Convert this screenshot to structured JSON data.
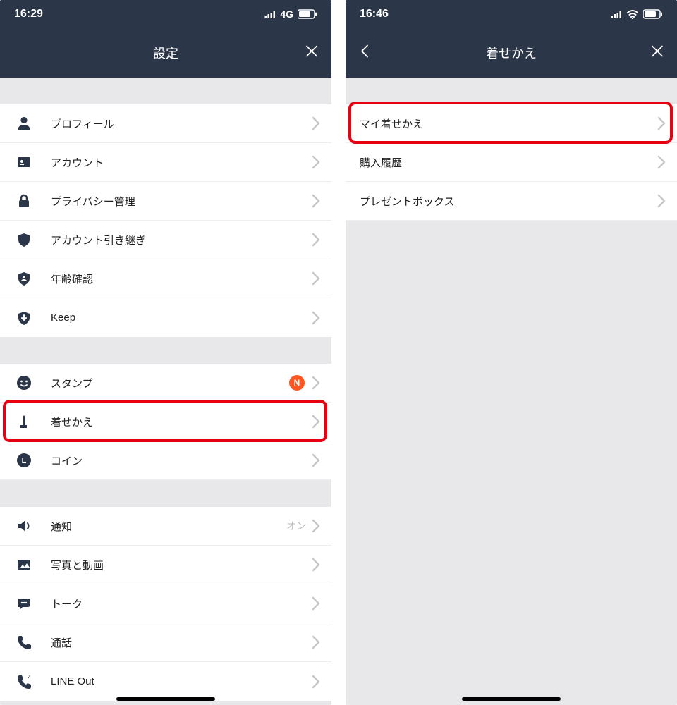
{
  "left": {
    "statusbar": {
      "time": "16:29",
      "network": "4G"
    },
    "navbar": {
      "title": "設定"
    },
    "groups": [
      {
        "items": [
          {
            "icon": "person-icon",
            "label": "プロフィール"
          },
          {
            "icon": "id-card-icon",
            "label": "アカウント"
          },
          {
            "icon": "lock-icon",
            "label": "プライバシー管理"
          },
          {
            "icon": "shield-icon",
            "label": "アカウント引き継ぎ"
          },
          {
            "icon": "shield-person-icon",
            "label": "年齢確認"
          },
          {
            "icon": "keep-icon",
            "label": "Keep"
          }
        ]
      },
      {
        "items": [
          {
            "icon": "smiley-icon",
            "label": "スタンプ",
            "badge": "N"
          },
          {
            "icon": "brush-icon",
            "label": "着せかえ",
            "highlight": true
          },
          {
            "icon": "coin-icon",
            "label": "コイン"
          }
        ]
      },
      {
        "items": [
          {
            "icon": "speaker-icon",
            "label": "通知",
            "value": "オン"
          },
          {
            "icon": "photo-icon",
            "label": "写真と動画"
          },
          {
            "icon": "chat-icon",
            "label": "トーク"
          },
          {
            "icon": "phone-icon",
            "label": "通話"
          },
          {
            "icon": "phone-out-icon",
            "label": "LINE Out"
          }
        ]
      }
    ]
  },
  "right": {
    "statusbar": {
      "time": "16:46"
    },
    "navbar": {
      "title": "着せかえ"
    },
    "group": {
      "items": [
        {
          "label": "マイ着せかえ",
          "highlight": true
        },
        {
          "label": "購入履歴"
        },
        {
          "label": "プレゼントボックス"
        }
      ]
    }
  }
}
